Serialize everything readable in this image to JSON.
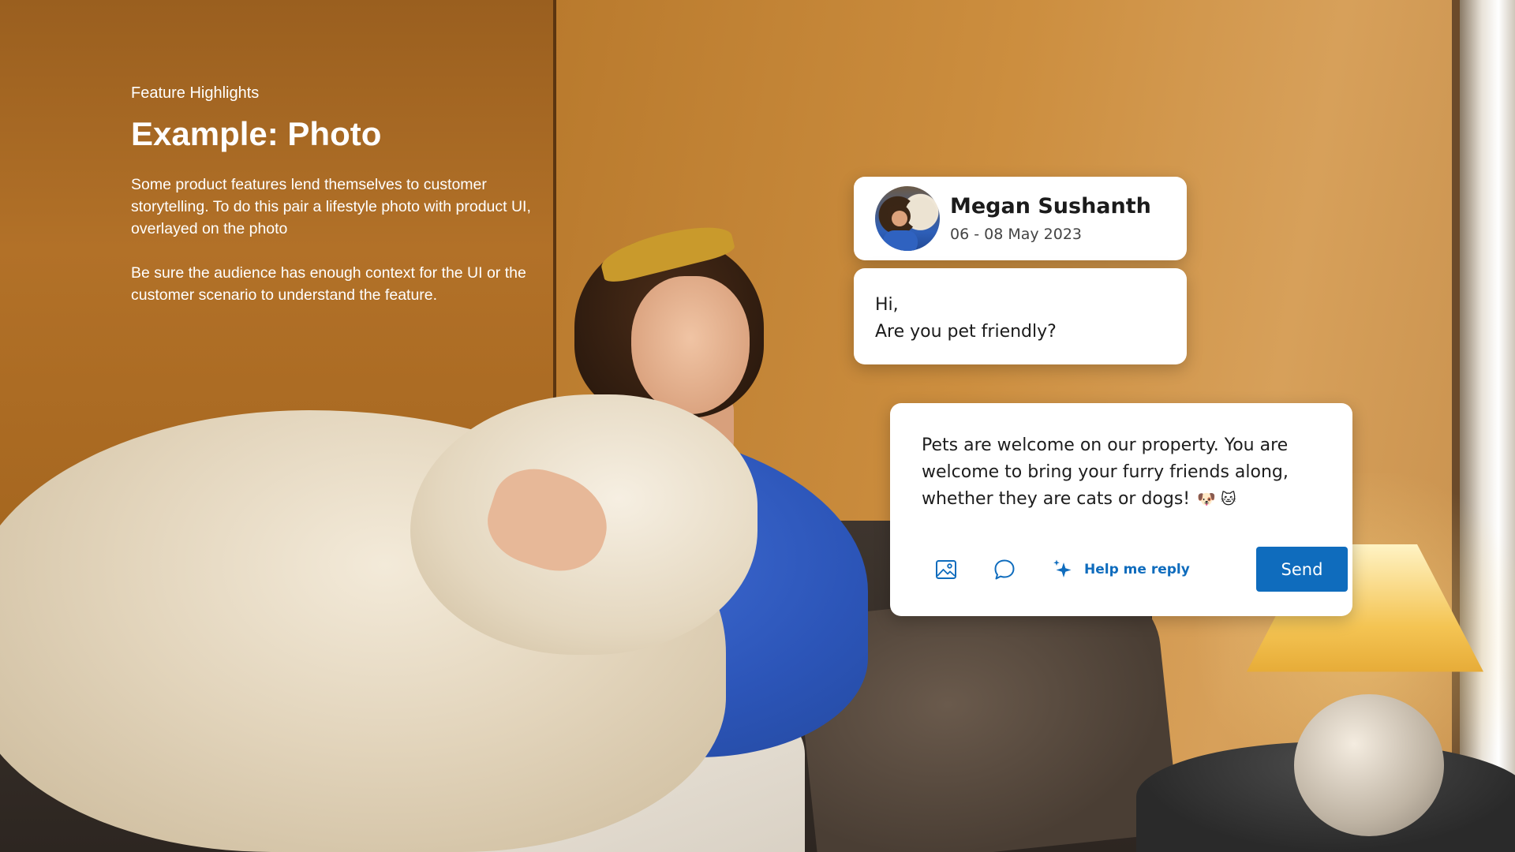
{
  "slide": {
    "eyebrow": "Feature Highlights",
    "title": "Example: Photo",
    "paragraphs": [
      "Some product features lend themselves to customer storytelling. To do this pair a lifestyle photo with product UI, overlayed on the photo",
      "Be sure the audience has enough context for the UI or the customer scenario to understand the feature."
    ]
  },
  "profile": {
    "name": "Megan Sushanth",
    "dates": "06 - 08 May 2023",
    "avatar_icon": "avatar-photo"
  },
  "message": {
    "lines": [
      "Hi,",
      "Are you pet friendly?"
    ]
  },
  "reply": {
    "text": "Pets are welcome on our property. You are welcome to bring your furry friends along, whether they are cats or dogs!",
    "emojis": "🐶 🐱",
    "toolbar": {
      "image_icon": "image-icon",
      "chat_icon": "chat-bubble-icon",
      "sparkle_icon": "sparkle-icon",
      "help_label": "Help me reply",
      "send_label": "Send"
    }
  },
  "colors": {
    "accent": "#0f6cbd",
    "card_bg": "#ffffff",
    "text_on_photo": "#ffffff"
  }
}
